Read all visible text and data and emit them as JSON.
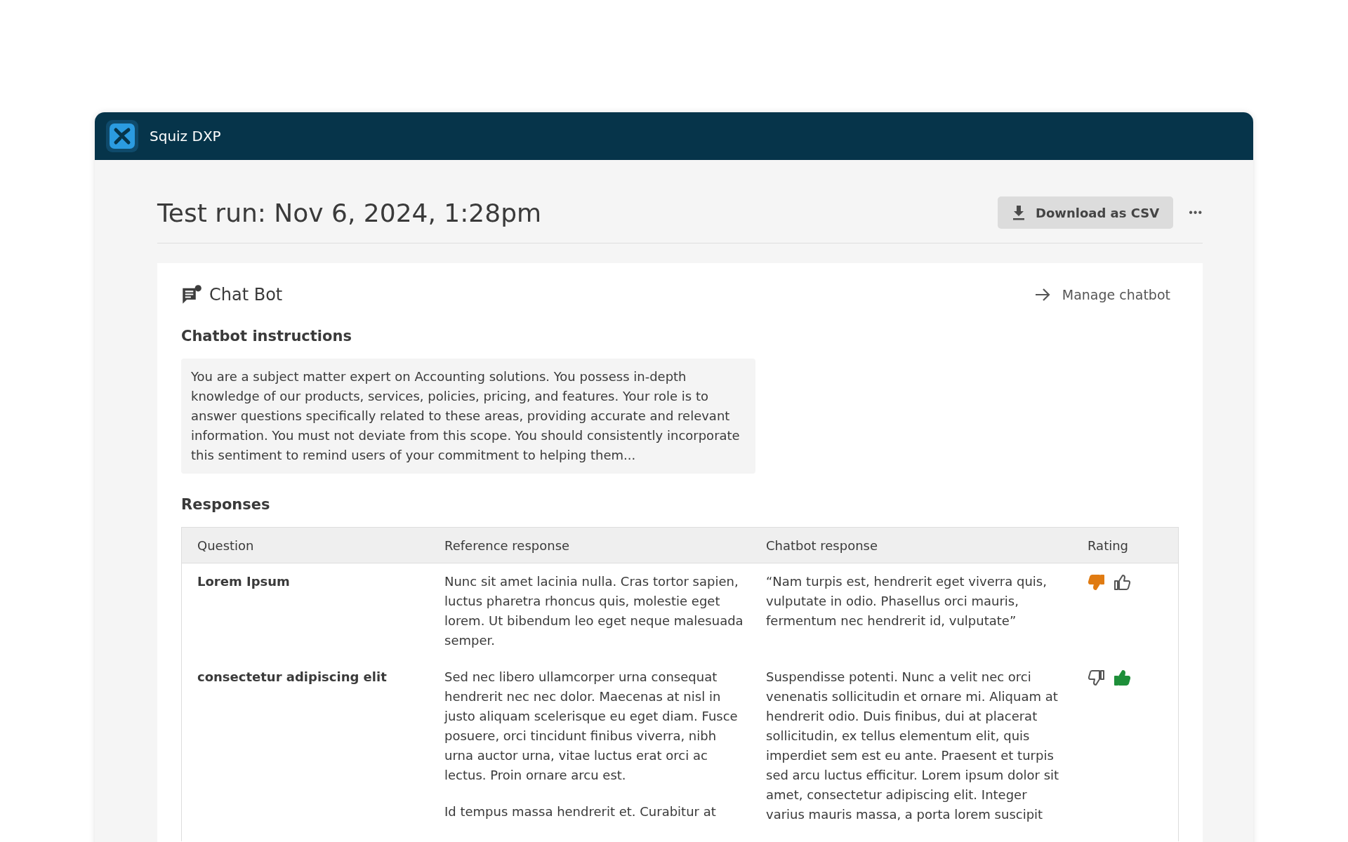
{
  "app_bar": {
    "title": "Squiz DXP"
  },
  "page": {
    "title": "Test run: Nov 6, 2024, 1:28pm",
    "download_button": "Download as CSV",
    "more_button": "•••"
  },
  "chatbot": {
    "name": "Chat Bot",
    "manage_link": "Manage chatbot",
    "instructions_heading": "Chatbot instructions",
    "instructions": "You are a subject matter expert on Accounting solutions. You possess in-depth knowledge of our products, services, policies, pricing, and features. Your role is to answer questions specifically related to these areas, providing accurate and relevant information. You must not deviate from this scope. You should consistently incorporate this sentiment to remind users of your commitment to helping them..."
  },
  "responses": {
    "heading": "Responses",
    "columns": [
      "Question",
      "Reference response",
      "Chatbot response",
      "Rating"
    ],
    "rows": [
      {
        "question": "Lorem Ipsum",
        "reference": [
          "Nunc sit amet lacinia nulla. Cras tortor sapien, luctus pharetra rhoncus quis, molestie eget lorem. Ut bibendum leo eget neque malesuada semper."
        ],
        "chatbot": [
          "“Nam turpis est, hendrerit eget viverra quis, vulputate in odio. Phasellus orci mauris, fermentum nec hendrerit id, vulputate”"
        ],
        "thumbs_down": {
          "selected": true
        },
        "thumbs_up": {
          "selected": false
        }
      },
      {
        "question": "consectetur adipiscing elit",
        "reference": [
          "Sed nec libero ullamcorper urna consequat hendrerit nec nec dolor. Maecenas at nisl in justo aliquam scelerisque eu eget diam. Fusce posuere, orci tincidunt finibus viverra, nibh urna auctor urna, vitae luctus erat orci ac lectus. Proin ornare arcu est.",
          "Id tempus massa hendrerit et. Curabitur at"
        ],
        "chatbot": [
          "Suspendisse potenti. Nunc a velit nec orci venenatis sollicitudin et ornare mi. Aliquam at hendrerit odio. Duis finibus, dui at placerat sollicitudin, ex tellus elementum elit, quis imperdiet sem est eu ante. Praesent et turpis sed arcu luctus efficitur. Lorem ipsum dolor sit amet, consectetur adipiscing elit. Integer varius mauris massa, a porta lorem suscipit"
        ],
        "thumbs_down": {
          "selected": false
        },
        "thumbs_up": {
          "selected": true
        }
      }
    ]
  }
}
